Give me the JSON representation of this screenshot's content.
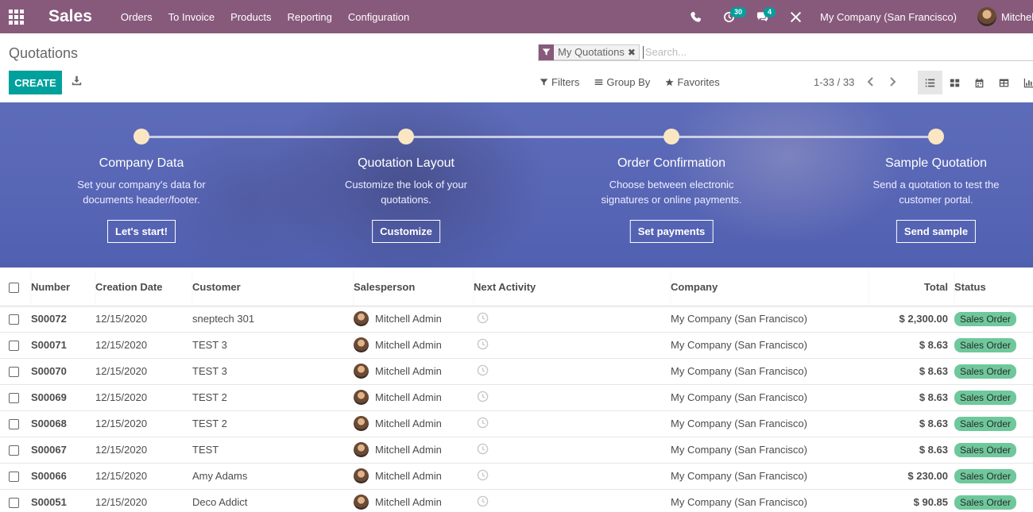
{
  "navbar": {
    "app_name": "Sales",
    "menu": [
      "Orders",
      "To Invoice",
      "Products",
      "Reporting",
      "Configuration"
    ],
    "activity_count": "30",
    "message_count": "4",
    "company": "My Company (San Francisco)",
    "user": "Mitchell Admin",
    "bg_color": "#875a7b"
  },
  "control": {
    "title": "Quotations",
    "facet_label": "My Quotations",
    "search_placeholder": "Search...",
    "create_label": "CREATE",
    "filters_label": "Filters",
    "groupby_label": "Group By",
    "favorites_label": "Favorites",
    "pager": "1-33 / 33",
    "accent_color": "#00a09d"
  },
  "onboarding": {
    "steps": [
      {
        "title": "Company Data",
        "desc": "Set your company's data for documents header/footer.",
        "button": "Let's start!"
      },
      {
        "title": "Quotation Layout",
        "desc": "Customize the look of your quotations.",
        "button": "Customize"
      },
      {
        "title": "Order Confirmation",
        "desc": "Choose between electronic signatures or online payments.",
        "button": "Set payments"
      },
      {
        "title": "Sample Quotation",
        "desc": "Send a quotation to test the customer portal.",
        "button": "Send sample"
      }
    ]
  },
  "table": {
    "headers": {
      "number": "Number",
      "date": "Creation Date",
      "customer": "Customer",
      "salesperson": "Salesperson",
      "activity": "Next Activity",
      "company": "Company",
      "total": "Total",
      "status": "Status"
    },
    "rows": [
      {
        "number": "S00072",
        "date": "12/15/2020",
        "customer": "sneptech 301",
        "salesperson": "Mitchell Admin",
        "company": "My Company (San Francisco)",
        "total": "$ 2,300.00",
        "status": "Sales Order"
      },
      {
        "number": "S00071",
        "date": "12/15/2020",
        "customer": "TEST 3",
        "salesperson": "Mitchell Admin",
        "company": "My Company (San Francisco)",
        "total": "$ 8.63",
        "status": "Sales Order"
      },
      {
        "number": "S00070",
        "date": "12/15/2020",
        "customer": "TEST 3",
        "salesperson": "Mitchell Admin",
        "company": "My Company (San Francisco)",
        "total": "$ 8.63",
        "status": "Sales Order"
      },
      {
        "number": "S00069",
        "date": "12/15/2020",
        "customer": "TEST 2",
        "salesperson": "Mitchell Admin",
        "company": "My Company (San Francisco)",
        "total": "$ 8.63",
        "status": "Sales Order"
      },
      {
        "number": "S00068",
        "date": "12/15/2020",
        "customer": "TEST 2",
        "salesperson": "Mitchell Admin",
        "company": "My Company (San Francisco)",
        "total": "$ 8.63",
        "status": "Sales Order"
      },
      {
        "number": "S00067",
        "date": "12/15/2020",
        "customer": "TEST",
        "salesperson": "Mitchell Admin",
        "company": "My Company (San Francisco)",
        "total": "$ 8.63",
        "status": "Sales Order"
      },
      {
        "number": "S00066",
        "date": "12/15/2020",
        "customer": "Amy Adams",
        "salesperson": "Mitchell Admin",
        "company": "My Company (San Francisco)",
        "total": "$ 230.00",
        "status": "Sales Order"
      },
      {
        "number": "S00051",
        "date": "12/15/2020",
        "customer": "Deco Addict",
        "salesperson": "Mitchell Admin",
        "company": "My Company (San Francisco)",
        "total": "$ 90.85",
        "status": "Sales Order"
      }
    ],
    "status_color": "#6ec89b"
  }
}
